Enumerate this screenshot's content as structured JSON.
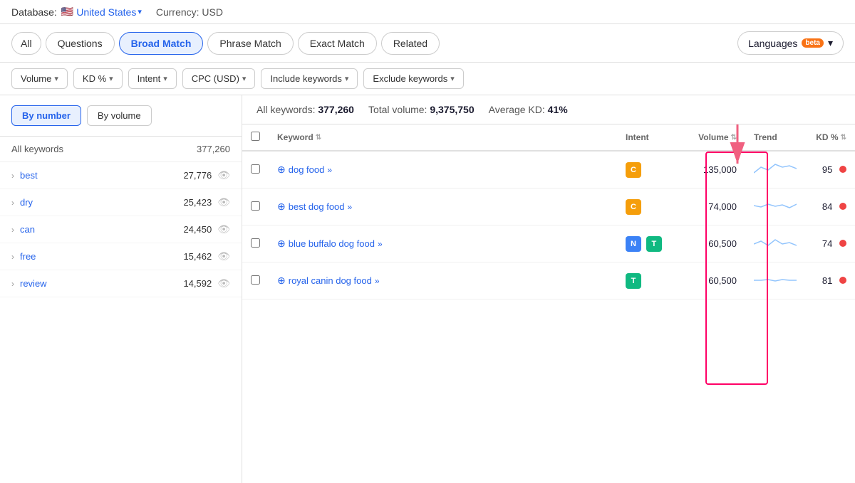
{
  "topBar": {
    "dbLabel": "Database:",
    "dbLink": "United States",
    "flag": "🇺🇸",
    "currency": "Currency: USD"
  },
  "tabs": {
    "items": [
      {
        "id": "all",
        "label": "All",
        "active": false
      },
      {
        "id": "questions",
        "label": "Questions",
        "active": false
      },
      {
        "id": "broad-match",
        "label": "Broad Match",
        "active": true
      },
      {
        "id": "phrase-match",
        "label": "Phrase Match",
        "active": false
      },
      {
        "id": "exact-match",
        "label": "Exact Match",
        "active": false
      },
      {
        "id": "related",
        "label": "Related",
        "active": false
      }
    ],
    "languages": "Languages",
    "betaBadge": "beta"
  },
  "filters": [
    {
      "id": "volume",
      "label": "Volume",
      "hasChevron": true
    },
    {
      "id": "kd",
      "label": "KD %",
      "hasChevron": true
    },
    {
      "id": "intent",
      "label": "Intent",
      "hasChevron": true
    },
    {
      "id": "cpc",
      "label": "CPC (USD)",
      "hasChevron": true
    },
    {
      "id": "include",
      "label": "Include keywords",
      "hasChevron": true
    },
    {
      "id": "exclude",
      "label": "Exclude keywords",
      "hasChevron": true
    }
  ],
  "sidebar": {
    "viewBtns": [
      {
        "id": "by-number",
        "label": "By number",
        "active": true
      },
      {
        "id": "by-volume",
        "label": "By volume",
        "active": false
      }
    ],
    "subheader": {
      "label": "All keywords",
      "count": "377,260"
    },
    "items": [
      {
        "keyword": "best",
        "count": "27,776"
      },
      {
        "keyword": "dry",
        "count": "25,423"
      },
      {
        "keyword": "can",
        "count": "24,450"
      },
      {
        "keyword": "free",
        "count": "15,462"
      },
      {
        "keyword": "review",
        "count": "14,592"
      }
    ]
  },
  "stats": {
    "allKeywordsLabel": "All keywords:",
    "allKeywordsValue": "377,260",
    "totalVolumeLabel": "Total volume:",
    "totalVolumeValue": "9,375,750",
    "avgKdLabel": "Average KD:",
    "avgKdValue": "41%"
  },
  "table": {
    "columns": [
      {
        "id": "keyword",
        "label": "Keyword"
      },
      {
        "id": "intent",
        "label": "Intent"
      },
      {
        "id": "volume",
        "label": "Volume"
      },
      {
        "id": "trend",
        "label": "Trend"
      },
      {
        "id": "kd",
        "label": "KD %"
      }
    ],
    "rows": [
      {
        "keyword": "dog food",
        "intents": [
          {
            "badge": "C",
            "class": "intent-c"
          }
        ],
        "volume": "135,000",
        "kd": "95",
        "trend": "up-down"
      },
      {
        "keyword": "best dog food",
        "intents": [
          {
            "badge": "C",
            "class": "intent-c"
          }
        ],
        "volume": "74,000",
        "kd": "84",
        "trend": "flat"
      },
      {
        "keyword": "blue buffalo dog food",
        "intents": [
          {
            "badge": "N",
            "class": "intent-n"
          },
          {
            "badge": "T",
            "class": "intent-t"
          }
        ],
        "volume": "60,500",
        "kd": "74",
        "trend": "wavy"
      },
      {
        "keyword": "royal canin dog food",
        "intents": [
          {
            "badge": "T",
            "class": "intent-t"
          }
        ],
        "volume": "60,500",
        "kd": "81",
        "trend": "flat2"
      }
    ]
  }
}
